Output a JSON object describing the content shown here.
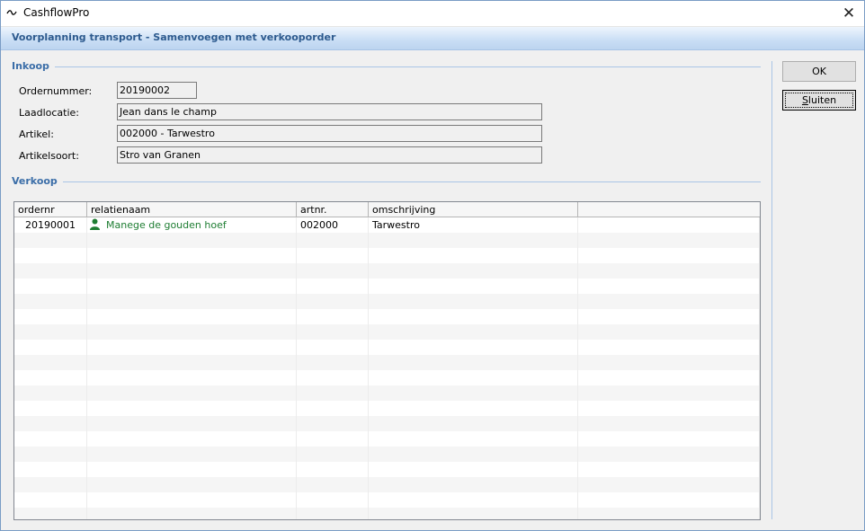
{
  "window": {
    "title": "CashflowPro",
    "close_glyph": "✕"
  },
  "header": {
    "title": "Voorplanning transport - Samenvoegen met verkooporder"
  },
  "inkoop": {
    "section_title": "Inkoop",
    "fields": {
      "ordernummer": {
        "label": "Ordernummer:",
        "value": "20190002"
      },
      "laadlocatie": {
        "label": "Laadlocatie:",
        "value": "Jean dans le champ"
      },
      "artikel": {
        "label": "Artikel:",
        "value": "002000 - Tarwestro"
      },
      "artikelsoort": {
        "label": "Artikelsoort:",
        "value": "Stro van Granen"
      }
    }
  },
  "verkoop": {
    "section_title": "Verkoop",
    "columns": [
      "ordernr",
      "relatienaam",
      "artnr.",
      "omschrijving"
    ],
    "rows": [
      {
        "ordernr": "20190001",
        "relatienaam": "Manege de gouden hoef",
        "artnr": "002000",
        "omschrijving": "Tarwestro"
      }
    ]
  },
  "buttons": {
    "ok": "OK",
    "sluiten_underlined": "S",
    "sluiten_rest": "luiten"
  },
  "icons": {
    "app": "cashflow-wave-icon",
    "relation": "person-icon",
    "close": "close-icon"
  },
  "colors": {
    "accent": "#3b6ea8",
    "relation_link": "#1e7d32",
    "header_text": "#2d5a8e"
  }
}
